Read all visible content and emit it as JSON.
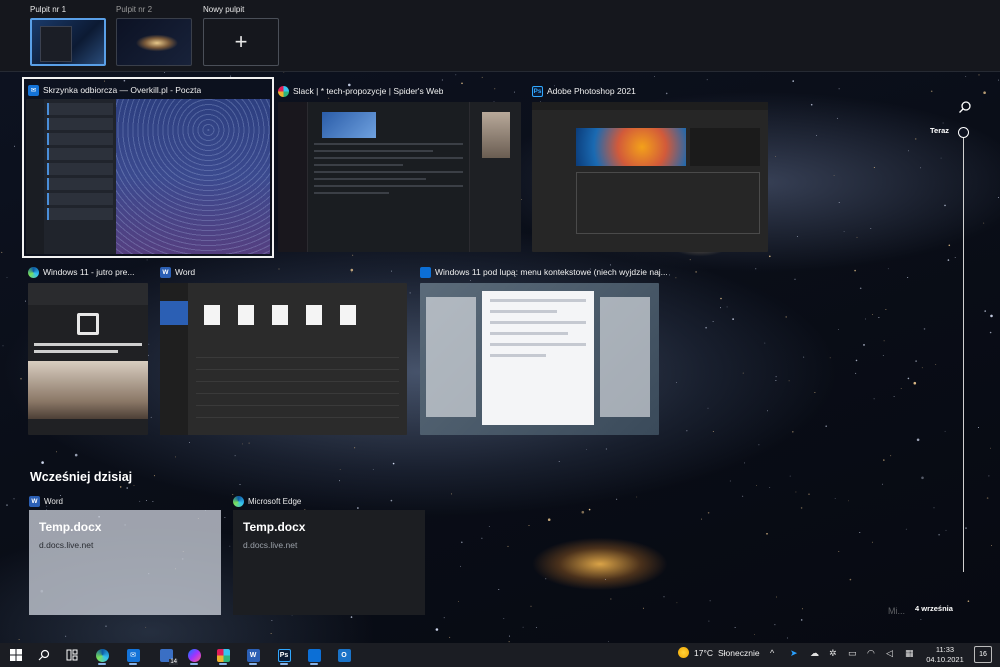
{
  "desktops": [
    {
      "label": "Pulpit nr 1",
      "active": true
    },
    {
      "label": "Pulpit nr 2",
      "active": false
    },
    {
      "label": "Nowy pulpit",
      "icon": "plus-icon"
    }
  ],
  "windows": [
    {
      "title": "Skrzynka odbiorcza — Overkill.pl - Poczta",
      "app": "mail"
    },
    {
      "title": "Slack | * tech-propozycje | Spider's Web",
      "app": "slack"
    },
    {
      "title": "Adobe Photoshop 2021",
      "app": "photoshop"
    },
    {
      "title": "Windows 11 - jutro pre...",
      "app": "edge"
    },
    {
      "title": "Word",
      "app": "word"
    },
    {
      "title": "Windows 11 pod lupą: menu kontekstowe (niech wyjdzie naj...",
      "app": "trello"
    }
  ],
  "history": {
    "title": "Wcześniej dzisiaj",
    "items": [
      {
        "app": "Word",
        "doc": "Temp.docx",
        "url": "d.docs.live.net"
      },
      {
        "app": "Microsoft Edge",
        "doc": "Temp.docx",
        "url": "d.docs.live.net"
      }
    ]
  },
  "timeline": {
    "now_label": "Teraz",
    "date_label": "4 września"
  },
  "watermark": "Mi...",
  "taskbar": {
    "weather_temp": "17°C",
    "weather_desc": "Słonecznie",
    "time": "11:33",
    "date": "04.10.2021",
    "notifications": "16",
    "files_badge": "14"
  },
  "colors": {
    "accent": "#5aa0e8",
    "taskbar": "#1c1e24"
  }
}
